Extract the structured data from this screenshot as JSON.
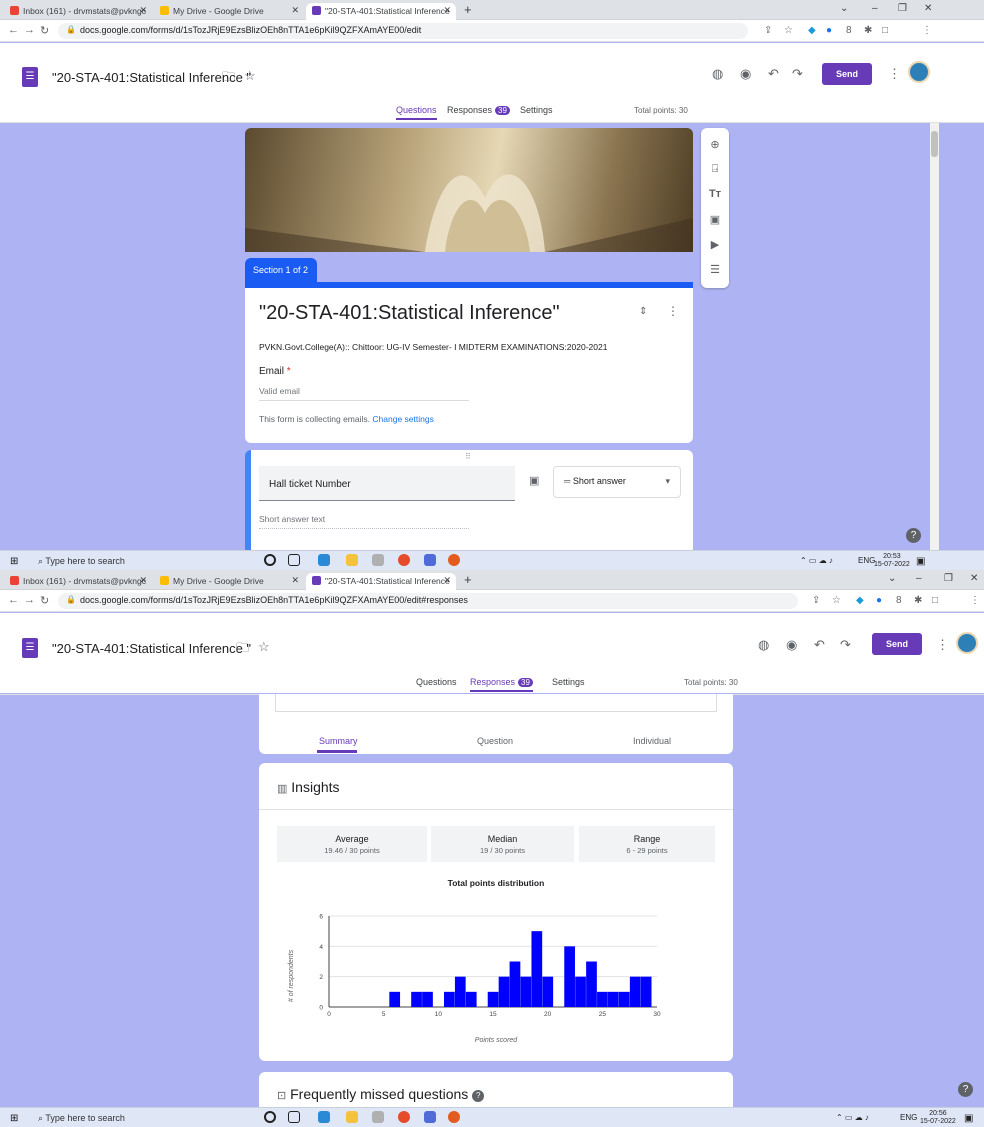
{
  "browser": {
    "tabs": [
      "Inbox (161) - drvmstats@pvkngc",
      "My Drive - Google Drive",
      "\"20-STA-401:Statistical Inference"
    ],
    "url1": "docs.google.com/forms/d/1sTozJRjE9EzsBlizOEh8nTTA1e6pKil9QZFXAmAYE00/edit",
    "url2": "docs.google.com/forms/d/1sTozJRjE9EzsBlizOEh8nTTA1e6pKil9QZFXAmAYE00/edit#responses"
  },
  "form": {
    "doc_title": "\"20-STA-401:Statistical Inference \"",
    "send_label": "Send",
    "tabs": {
      "questions": "Questions",
      "responses": "Responses",
      "responses_count": "39",
      "settings": "Settings"
    },
    "total_points": "Total points: 30",
    "section_tag": "Section 1 of 2",
    "title": "\"20-STA-401:Statistical Inference\"",
    "description": "PVKN.Govt.College(A):: Chittoor: UG-IV Semester- I MIDTERM EXAMINATIONS:2020-2021",
    "email_label": "Email",
    "email_required": "*",
    "email_placeholder": "Valid email",
    "collecting_note": "This form is collecting emails.",
    "change_settings": "Change settings",
    "question_title": "Hall ticket Number",
    "question_type": "Short answer",
    "answer_placeholder": "Short answer text"
  },
  "responses": {
    "subtabs": [
      "Summary",
      "Question",
      "Individual"
    ],
    "insights_title": "Insights",
    "stats": [
      {
        "label": "Average",
        "value": "19.46 / 30 points"
      },
      {
        "label": "Median",
        "value": "19 / 30 points"
      },
      {
        "label": "Range",
        "value": "6 - 29 points"
      }
    ],
    "missed_title": "Frequently missed questions"
  },
  "taskbar": {
    "search_placeholder": "Type here to search",
    "lang": "ENG",
    "time1": "20:53",
    "date1": "15-07-2022",
    "time2": "20:56",
    "date2": "15-07-2022"
  },
  "colors": {
    "accent": "#673ab7",
    "background": "#adb3f3",
    "section": "#1a5cf3",
    "bars": "#0000ff"
  },
  "chart_data": {
    "type": "bar",
    "title": "Total points distribution",
    "xlabel": "Points scored",
    "ylabel": "# of respondents",
    "x": [
      6,
      7,
      8,
      9,
      10,
      11,
      12,
      13,
      14,
      15,
      16,
      17,
      18,
      19,
      20,
      21,
      22,
      23,
      24,
      25,
      26,
      27,
      28,
      29
    ],
    "values": [
      1,
      0,
      1,
      1,
      0,
      1,
      2,
      1,
      0,
      1,
      2,
      3,
      2,
      5,
      2,
      0,
      4,
      2,
      3,
      1,
      1,
      1,
      2,
      2
    ],
    "xlim": [
      0,
      30
    ],
    "ylim": [
      0,
      6
    ],
    "xticks": [
      0,
      5,
      10,
      15,
      20,
      25,
      30
    ],
    "yticks": [
      0,
      2,
      4,
      6
    ],
    "grid": true
  }
}
